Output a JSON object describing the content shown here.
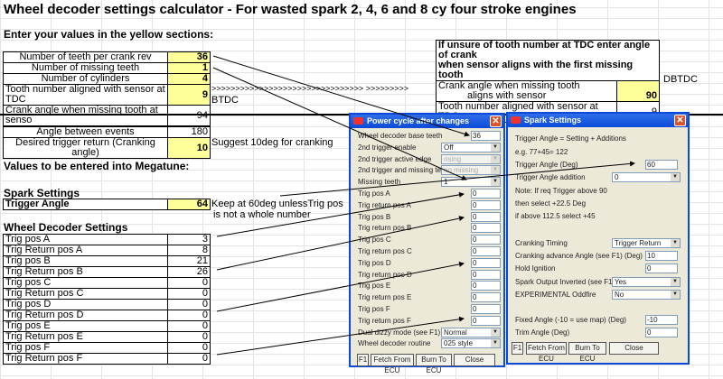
{
  "title": "Wheel decoder settings calculator - For wasted spark 2, 4, 6 and 8 cy four stroke engines",
  "instructions": "Enter your values in the yellow sections:",
  "inputs": [
    {
      "label": "Number of teeth per crank rev",
      "value": "36"
    },
    {
      "label": "Number of missing teeth",
      "value": "1"
    },
    {
      "label": "Number of cylinders",
      "value": "4"
    },
    {
      "label": "Tooth number aligned with sensor at TDC",
      "value": "9"
    },
    {
      "label": "Crank angle when missing tooth at senso",
      "value": "94"
    }
  ],
  "arrows_text": ">>>>>>>>>>>>>>>>>>>>>>>>>>>>>>>> >>>>>>>>>",
  "btdc": "BTDC",
  "helper": {
    "heading_line1": "If unsure of tooth number at TDC enter angle of crank",
    "heading_line2": "when sensor aligns with the first missing tooth",
    "crank_label_line1": "Crank angle when missing tooth",
    "crank_label_line2": "aligns with sensor",
    "crank_value": "90",
    "crank_unit": "DBTDC",
    "tooth_label": "Tooth number aligned with sensor at TDC =",
    "tooth_value": "9"
  },
  "events": {
    "angle_label": "Angle between events",
    "angle_value": "180",
    "return_label": "Desired trigger return (Cranking angle)",
    "return_value": "10",
    "return_note": "Suggest 10deg for cranking"
  },
  "megatune_heading": "Values to be entered into Megatune:",
  "spark": {
    "heading": "Spark Settings",
    "label": "Trigger Angle",
    "value": "64",
    "note_line1": "Keep at 60deg unlessTrig pos",
    "note_line2": "is not a whole number"
  },
  "wheel": {
    "heading": "Wheel Decoder Settings",
    "rows": [
      {
        "label": "Trig pos A",
        "value": "3"
      },
      {
        "label": "Trig Return pos A",
        "value": "8"
      },
      {
        "label": "Trig pos B",
        "value": "21"
      },
      {
        "label": "Trig Return pos B",
        "value": "26"
      },
      {
        "label": "Trig pos C",
        "value": "0"
      },
      {
        "label": "Trig Return pos C",
        "value": "0"
      },
      {
        "label": "Trig pos D",
        "value": "0"
      },
      {
        "label": "Trig Return pos D",
        "value": "0"
      },
      {
        "label": "Trig pos E",
        "value": "0"
      },
      {
        "label": "Trig Return pos E",
        "value": "0"
      },
      {
        "label": "Trig pos F",
        "value": "0"
      },
      {
        "label": "Trig Return pos F",
        "value": "0"
      }
    ]
  },
  "dialog1": {
    "title": "Power cycle after changes",
    "fields": [
      {
        "label": "Wheel decoder base teeth",
        "type": "input",
        "value": "36"
      },
      {
        "label": "2nd trigger enable",
        "type": "select",
        "value": "Off"
      },
      {
        "label": "2nd trigger active edge",
        "type": "select",
        "value": "rising",
        "disabled": true
      },
      {
        "label": "2nd trigger and missing teeth",
        "type": "select",
        "value": "no missing",
        "disabled": true
      },
      {
        "label": "Missing teeth",
        "type": "select",
        "value": "1"
      },
      {
        "label": "Trig pos A",
        "type": "input",
        "value": "0"
      },
      {
        "label": "Trig return pos A",
        "type": "input",
        "value": "0"
      },
      {
        "label": "Trig pos B",
        "type": "input",
        "value": "0"
      },
      {
        "label": "Trig return pos B",
        "type": "input",
        "value": "0"
      },
      {
        "label": "Trig pos C",
        "type": "input",
        "value": "0"
      },
      {
        "label": "Trig return pos C",
        "type": "input",
        "value": "0"
      },
      {
        "label": "Trig pos D",
        "type": "input",
        "value": "0"
      },
      {
        "label": "Trig return pos D",
        "type": "input",
        "value": "0"
      },
      {
        "label": "Trig pos E",
        "type": "input",
        "value": "0"
      },
      {
        "label": "Trig return pos E",
        "type": "input",
        "value": "0"
      },
      {
        "label": "Trig pos F",
        "type": "input",
        "value": "0"
      },
      {
        "label": "Trig return pos F",
        "type": "input",
        "value": "0"
      },
      {
        "label": "Dual dizzy mode (see F1)",
        "type": "select",
        "value": "Normal"
      },
      {
        "label": "Wheel decoder routine",
        "type": "select",
        "value": "025 style"
      }
    ],
    "buttons": [
      "F1",
      "Fetch From ECU",
      "Burn To ECU",
      "Close"
    ]
  },
  "dialog2": {
    "title": "Spark Settings",
    "fields": [
      {
        "label": "Trigger Angle = Setting + Additions",
        "type": "text"
      },
      {
        "label": "e.g. 77+45= 122",
        "type": "text"
      },
      {
        "label": "Trigger Angle  (Deg)",
        "type": "input",
        "value": "60"
      },
      {
        "label": "Trigger Angle addition",
        "type": "select",
        "value": "0"
      },
      {
        "label": "Note: If req Trigger above 90",
        "type": "text"
      },
      {
        "label": "then select +22.5 Deg",
        "type": "text"
      },
      {
        "label": "if above 112.5 select +45",
        "type": "text"
      },
      {
        "label": "Cranking Timing",
        "type": "select",
        "value": "Trigger Return"
      },
      {
        "label": "Cranking advance Angle (see F1) (Deg)",
        "type": "input",
        "value": "10"
      },
      {
        "label": "Hold Ignition",
        "type": "input",
        "value": "0"
      },
      {
        "label": "Spark Output Inverted (see F1)",
        "type": "select",
        "value": "Yes"
      },
      {
        "label": "EXPERIMENTAL Oddfire",
        "type": "select",
        "value": "No"
      },
      {
        "label": "Fixed Angle (-10 = use map) (Deg)",
        "type": "input",
        "value": "-10"
      },
      {
        "label": "Trim Angle (Deg)",
        "type": "input",
        "value": "0"
      }
    ],
    "buttons": [
      "F1",
      "Fetch From ECU",
      "Burn To ECU",
      "Close"
    ]
  },
  "colors": {
    "input_cell": "#ffff99",
    "titlebar": "#0a4ad8",
    "dialog_bg": "#ece9d8"
  }
}
